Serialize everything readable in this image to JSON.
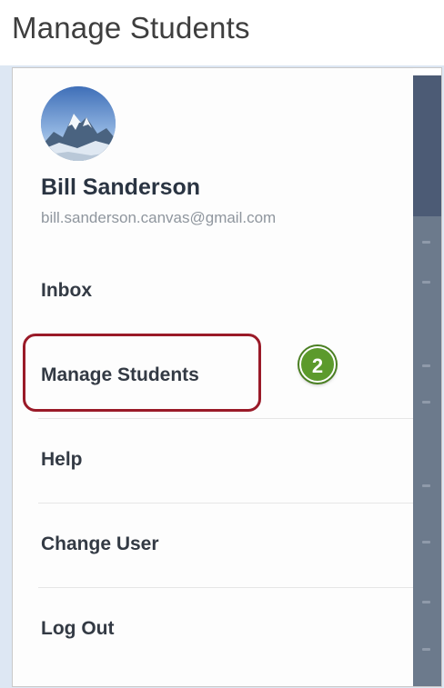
{
  "page": {
    "heading": "Manage Students"
  },
  "user": {
    "name": "Bill Sanderson",
    "email": "bill.sanderson.canvas@gmail.com",
    "avatar_icon": "mountain-avatar-icon"
  },
  "menu": {
    "items": [
      {
        "label": "Inbox"
      },
      {
        "label": "Manage Students"
      },
      {
        "label": "Help"
      },
      {
        "label": "Change User"
      },
      {
        "label": "Log Out"
      }
    ]
  },
  "annotation": {
    "step_number": "2",
    "badge_color": "#5c9a2c",
    "highlight_color": "#9a1a28"
  }
}
